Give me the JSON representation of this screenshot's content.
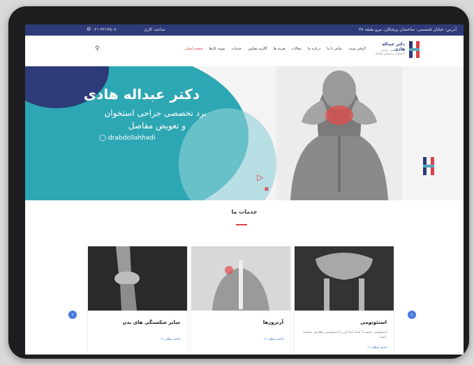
{
  "topbar": {
    "address": "آدرس: خیابان قمسمی، ساختمان پزشکان، نیرو طبقه ۳۸",
    "phone": "۰۲۱-۲۲۱۴۵۰۸۰",
    "hours": "ساعت کاری"
  },
  "logo": {
    "name": "دکتر عبداله هادی",
    "tagline": "بورد تخصصی جراحی استخوان و تعویض مفاصل"
  },
  "menu": [
    "صفحه اصلی",
    "نمونه کارها",
    "خدمات",
    "گالری تصاویر",
    "هزینه ها",
    "مقالات",
    "درباره ما",
    "تماس با ما",
    "گرفتن نوبت"
  ],
  "hero": {
    "title": "دکتر عبداله هادی",
    "subtitle1": "برد تخصصی جراحی استخوان",
    "subtitle2": "و تعویض مفاصل",
    "instagram": "drabdollahhadi"
  },
  "services": {
    "title": "خدمات ما",
    "cards": [
      {
        "title": "سایر شکستگی های بدن",
        "desc": "",
        "more": "ادامه مطلب >"
      },
      {
        "title": "آرتروزها",
        "desc": "",
        "more": "ادامه مطلب >"
      },
      {
        "title": "استئوتومی",
        "desc": "استئوتومی چیست؟ شاید ابتدا این را استئوتومی متعارفی نشنیده باشید؛",
        "more": "ادامه مطلب >"
      }
    ]
  },
  "colors": {
    "navy": "#2d3b78",
    "teal": "#2ea7b4",
    "red": "#d9414a",
    "link": "#2d6bd6"
  }
}
